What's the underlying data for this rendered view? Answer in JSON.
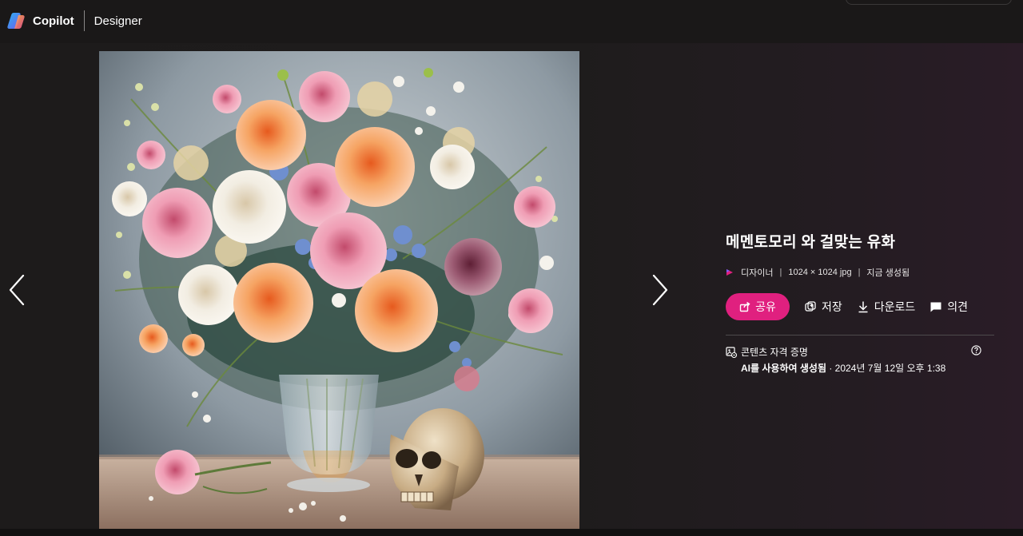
{
  "header": {
    "brand_name": "Copilot",
    "product_name": "Designer"
  },
  "navigation": {
    "prev_icon": "chevron-left-icon",
    "next_icon": "chevron-right-icon"
  },
  "image_panel": {
    "title": "메멘토모리 와 걸맞는 유화",
    "source": "디자이너",
    "dimensions": "1024 × 1024 jpg",
    "status": "지금 생성됨",
    "actions": {
      "share": "공유",
      "save": "저장",
      "download": "다운로드",
      "feedback": "의견"
    },
    "credentials": {
      "label": "콘텐츠 자격 증명",
      "generated_by": "AI를 사용하여 생성됨",
      "date": " · 2024년 7월 12일 오후 1:38"
    }
  },
  "colors": {
    "accent": "#e0207f",
    "background": "#1e1c1c",
    "topbar": "#1a1818"
  }
}
